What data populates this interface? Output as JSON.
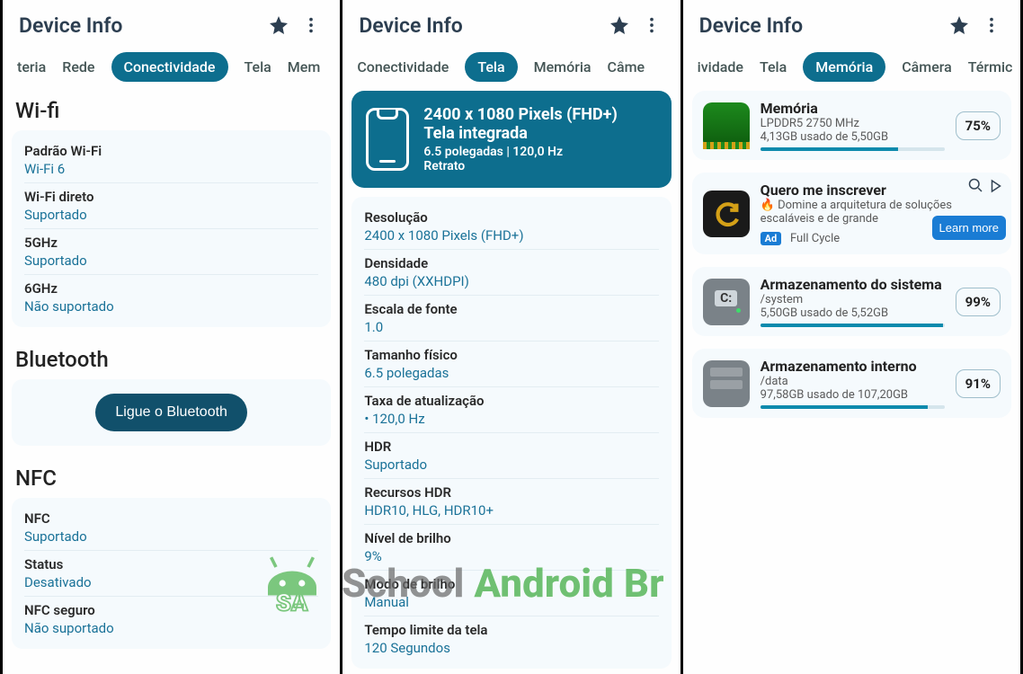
{
  "appbar": {
    "title": "Device Info"
  },
  "panel1": {
    "tabs": [
      "teria",
      "Rede",
      "Conectividade",
      "Tela",
      "Mem"
    ],
    "activeTab": "Conectividade",
    "wifi": {
      "heading": "Wi-fi",
      "rows": [
        {
          "label": "Padrão Wi-Fi",
          "value": "Wi-Fi 6"
        },
        {
          "label": "Wi-Fi direto",
          "value": "Suportado"
        },
        {
          "label": "5GHz",
          "value": "Suportado"
        },
        {
          "label": "6GHz",
          "value": "Não suportado"
        }
      ]
    },
    "bluetooth": {
      "heading": "Bluetooth",
      "button": "Ligue o Bluetooth"
    },
    "nfc": {
      "heading": "NFC",
      "rows": [
        {
          "label": "NFC",
          "value": "Suportado"
        },
        {
          "label": "Status",
          "value": "Desativado"
        },
        {
          "label": "NFC seguro",
          "value": "Não suportado"
        }
      ]
    }
  },
  "panel2": {
    "tabs": [
      "Conectividade",
      "Tela",
      "Memória",
      "Câme"
    ],
    "activeTab": "Tela",
    "hero": {
      "l1": "2400 x 1080 Pixels (FHD+)",
      "l2": "Tela integrada",
      "l3": "6.5 polegadas | 120,0 Hz",
      "l4": "Retrato"
    },
    "rows": [
      {
        "label": "Resolução",
        "value": "2400 x 1080 Pixels (FHD+)"
      },
      {
        "label": "Densidade",
        "value": "480 dpi (XXHDPI)"
      },
      {
        "label": "Escala de fonte",
        "value": "1.0"
      },
      {
        "label": "Tamanho físico",
        "value": "6.5 polegadas"
      },
      {
        "label": "Taxa de atualização",
        "value": "• 120,0 Hz"
      },
      {
        "label": "HDR",
        "value": "Suportado"
      },
      {
        "label": "Recursos HDR",
        "value": "HDR10, HLG, HDR10+"
      },
      {
        "label": "Nível de brilho",
        "value": "9%"
      },
      {
        "label": "Modo de brilho",
        "value": "Manual"
      },
      {
        "label": "Tempo limite da tela",
        "value": "120 Segundos"
      }
    ]
  },
  "panel3": {
    "tabs": [
      "ividade",
      "Tela",
      "Memória",
      "Câmera",
      "Térmic"
    ],
    "activeTab": "Memória",
    "memory": {
      "title": "Memória",
      "sub1": "LPDDR5 2750 MHz",
      "sub2": "4,13GB usado de 5,50GB",
      "pct": "75%",
      "pctVal": 75
    },
    "ad": {
      "title": "Quero me inscrever",
      "line": "🔥 Domine a arquitetura de soluções escaláveis e de grande",
      "badge": "Ad",
      "brand": "Full Cycle",
      "cta": "Learn more"
    },
    "sys": {
      "title": "Armazenamento do sistema",
      "sub1": "/system",
      "sub2": "5,50GB usado de 5,52GB",
      "pct": "99%",
      "pctVal": 99
    },
    "internal": {
      "title": "Armazenamento interno",
      "sub1": "/data",
      "sub2": "97,58GB usado de 107,20GB",
      "pct": "91%",
      "pctVal": 91
    }
  },
  "watermark": {
    "t1": "School ",
    "t2": "Android Br"
  }
}
